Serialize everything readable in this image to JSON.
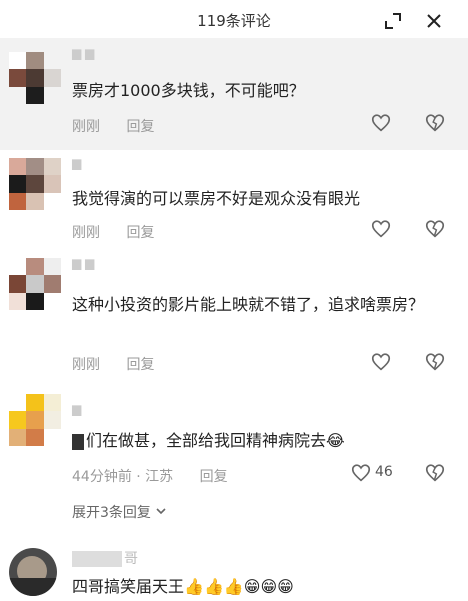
{
  "header": {
    "title": "119条评论"
  },
  "comments": [
    {
      "text": "票房才1000多块钱，不可能吧？",
      "time": "刚刚",
      "reply": "回复"
    },
    {
      "text": "我觉得演的可以票房不好是观众没有眼光",
      "time": "刚刚",
      "reply": "回复"
    },
    {
      "text": "这种小投资的影片能上映就不错了，追求啥票房？",
      "time": "刚刚",
      "reply": "回复"
    },
    {
      "text": "们在做甚，全部给我回精神病院去",
      "time": "44分钟前 · 江苏",
      "reply": "回复",
      "likes": "46",
      "expand": "展开3条回复"
    },
    {
      "username": "哥",
      "text": "四哥搞笑届天王"
    }
  ],
  "icons": {
    "minimize": "minimize-icon",
    "close": "close-icon",
    "like": "heart-icon",
    "dislike": "broken-heart-icon"
  },
  "colors": {
    "highlight": "#f2f2f2",
    "meta": "#9a9a9a"
  }
}
